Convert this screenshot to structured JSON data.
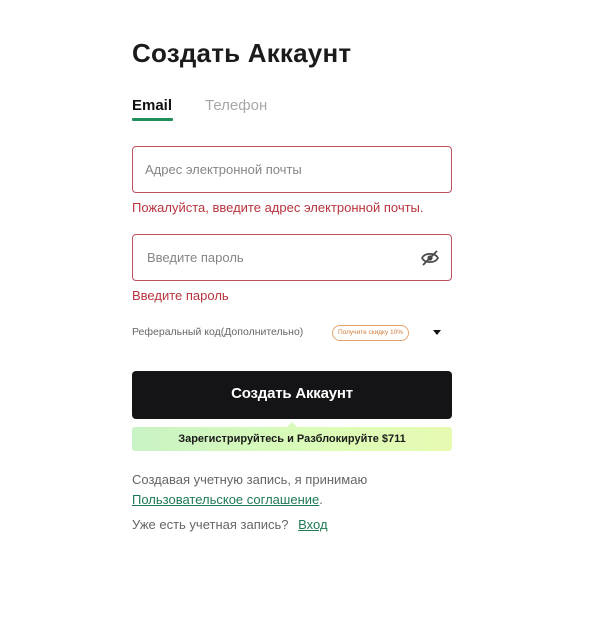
{
  "header": {
    "title": "Создать Аккаунт"
  },
  "tabs": [
    {
      "label": "Email",
      "active": true
    },
    {
      "label": "Телефон",
      "active": false
    }
  ],
  "email": {
    "placeholder": "Адрес электронной почты",
    "value": "",
    "error": "Пожалуйста, введите адрес электронной почты."
  },
  "password": {
    "placeholder": "Введите пароль",
    "value": "",
    "error": "Введите пароль",
    "toggle_icon": "eye-slash-icon"
  },
  "referral": {
    "label": "Реферальный код(Дополнительно)",
    "badge": "Получите скидку 10%",
    "caret_icon": "caret-down-icon"
  },
  "submit": {
    "label": "Создать Аккаунт"
  },
  "promo": {
    "text": "Зарегистрируйтесь и Разблокируйте $711"
  },
  "terms": {
    "line1": "Создавая учетную запись, я принимаю",
    "link": "Пользовательское соглашение",
    "suffix": "."
  },
  "login": {
    "prompt": "Уже есть учетная запись?",
    "link": "Вход"
  },
  "colors": {
    "accent": "#1f8f5c",
    "error": "#b8343f",
    "error_border": "#c0525e",
    "button_bg": "#141416",
    "badge": "#d17b3a",
    "link": "#1e7a53"
  }
}
